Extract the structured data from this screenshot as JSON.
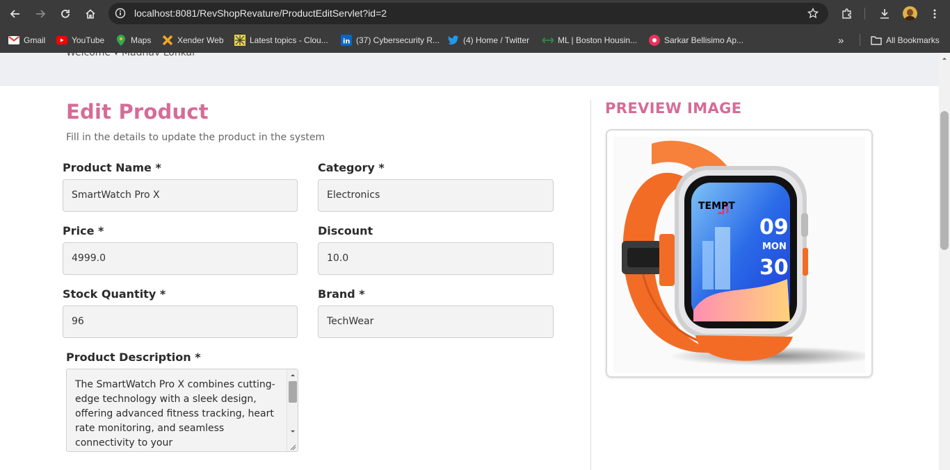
{
  "browser": {
    "url": "localhost:8081/RevShopRevature/ProductEditServlet?id=2",
    "bookmarks": [
      {
        "label": "Gmail",
        "icon": "gmail-icon"
      },
      {
        "label": "YouTube",
        "icon": "youtube-icon"
      },
      {
        "label": "Maps",
        "icon": "maps-icon"
      },
      {
        "label": "Xender Web",
        "icon": "xender-icon"
      },
      {
        "label": "Latest topics - Clou...",
        "icon": "forum-icon"
      },
      {
        "label": "(37) Cybersecurity R...",
        "icon": "linkedin-icon"
      },
      {
        "label": "(4) Home / Twitter",
        "icon": "twitter-icon"
      },
      {
        "label": "ML | Boston Housin...",
        "icon": "gfg-icon"
      },
      {
        "label": "Sarkar Bellisimo Ap...",
        "icon": "app-icon"
      }
    ],
    "more_label": "»",
    "all_bookmarks": "All Bookmarks"
  },
  "header": {
    "welcome": "Welcome   ▾   Madhav Lohkar"
  },
  "form": {
    "title": "Edit Product",
    "subtitle": "Fill in the details to update the product in the system",
    "product_name_label": "Product Name *",
    "product_name_value": "SmartWatch Pro X",
    "category_label": "Category *",
    "category_value": "Electronics",
    "price_label": "Price *",
    "price_value": "4999.0",
    "discount_label": "Discount",
    "discount_value": "10.0",
    "stock_label": "Stock Quantity *",
    "stock_value": "96",
    "brand_label": "Brand *",
    "brand_value": "TechWear",
    "description_label": "Product Description *",
    "description_value": "The SmartWatch Pro X combines cutting-edge technology with a sleek design, offering advanced fitness tracking, heart rate monitoring, and seamless connectivity to your"
  },
  "preview": {
    "title": "PREVIEW IMAGE",
    "brand_text": "TEMPT",
    "hour": "09",
    "day": "MON",
    "date": "30"
  },
  "colors": {
    "accent": "#d56c98",
    "strap": "#f36c26",
    "screen": "#1f3bd8"
  }
}
